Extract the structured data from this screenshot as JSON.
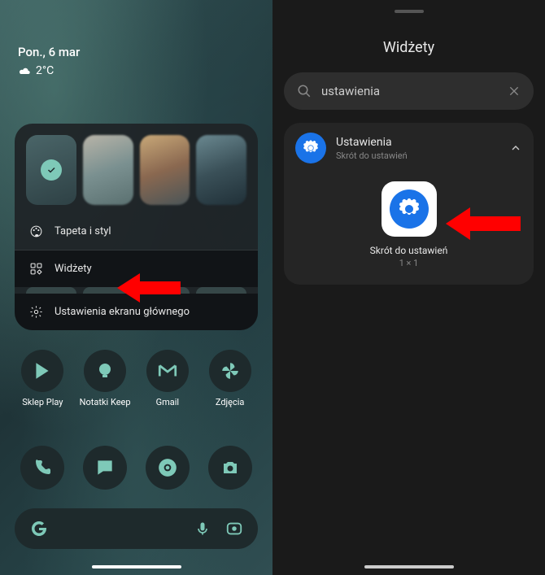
{
  "home": {
    "date": "Pon., 6 mar",
    "temp": "2°C",
    "menu": {
      "wallpaper": "Tapeta i styl",
      "widgets": "Widżety",
      "settings": "Ustawienia ekranu głównego"
    },
    "apps": {
      "play": "Sklep Play",
      "keep": "Notatki Keep",
      "gmail": "Gmail",
      "photos": "Zdjęcia"
    }
  },
  "widgets": {
    "title": "Widżety",
    "search": "ustawienia",
    "result": {
      "name": "Ustawienia",
      "sub": "Skrót do ustawień",
      "preview_label": "Skrót do ustawień",
      "preview_size": "1 × 1"
    }
  }
}
